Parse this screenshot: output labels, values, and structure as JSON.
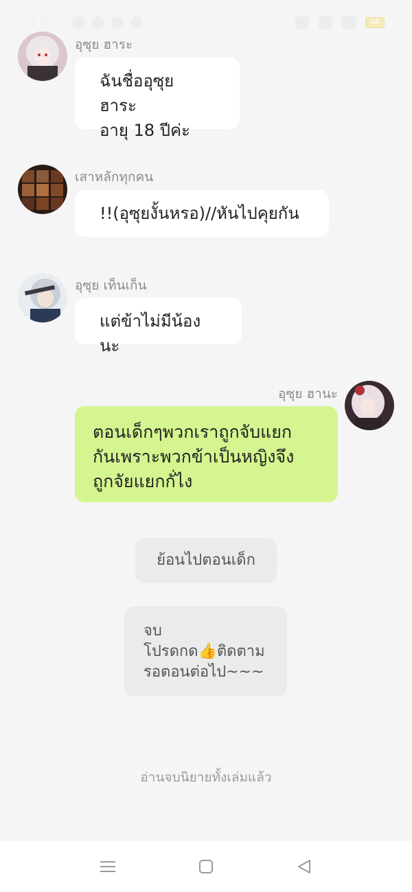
{
  "status_bar": {
    "time": "16:14",
    "battery": "48"
  },
  "messages": [
    {
      "sender": "อุซุย ฮาระ",
      "text": "ฉันชื่ออุซุย ฮาระ\nอายุ 18 ปีค่ะ",
      "side": "left"
    },
    {
      "sender": "เสาหลักทุกคน",
      "text": "!!(อุซุยงั้นหรอ)//หันไปคุยกัน",
      "side": "left"
    },
    {
      "sender": "อุซุย เท็นเก็น",
      "text": "แต่ข้าไม่มีน้องนะ",
      "side": "left"
    },
    {
      "sender": "อุซุย ฮานะ",
      "text": "ตอนเด็กๆพวกเราถูกจับแยก\nกันเพราะพวกข้าเป็นหญิงจึง\nถูกจัยแยกกั่ไง",
      "side": "right"
    }
  ],
  "narration": [
    {
      "text": "ย้อนไปตอนเด็ก"
    },
    {
      "text": "จบ\nโปรดกด👍ติดตาม\nรอตอนต่อไป~~~"
    }
  ],
  "footer_note": "อ่านจบนิยายทั้งเล่มแล้ว",
  "icons": {
    "nav_menu": "menu-icon",
    "nav_home": "square-home-icon",
    "nav_back": "triangle-back-icon"
  },
  "colors": {
    "own_bubble": "#d4f58f",
    "other_bubble": "#ffffff",
    "narration_bubble": "#ebebeb",
    "background": "#f5f5f5"
  }
}
